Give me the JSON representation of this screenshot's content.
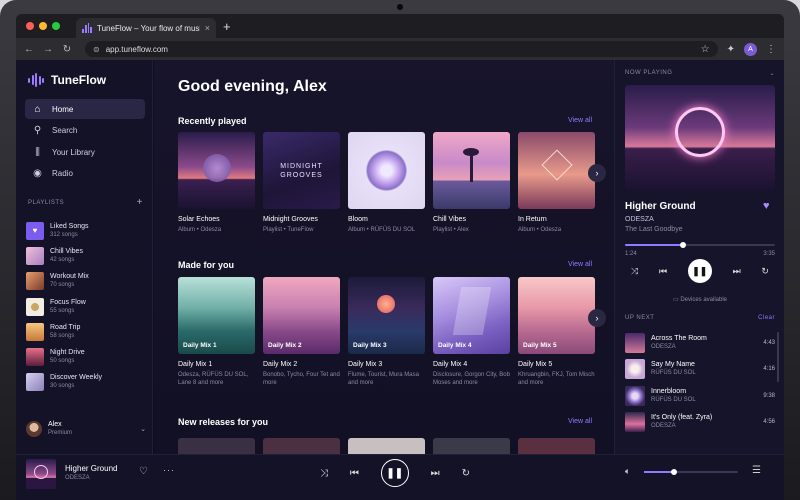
{
  "browser": {
    "tab_title": "TuneFlow – Your flow of music",
    "tab_close": "×",
    "new_tab": "+",
    "url": "app.tuneflow.com",
    "profile_initial": "A",
    "dot_colors": [
      "#ff5f57",
      "#febc2e",
      "#28c840"
    ]
  },
  "brand": {
    "name": "TuneFlow",
    "accent": "#9b7bff"
  },
  "nav": [
    {
      "label": "Home",
      "icon": "home-icon",
      "glyph": "⌂",
      "active": true
    },
    {
      "label": "Search",
      "icon": "search-icon",
      "glyph": "⚲",
      "active": false
    },
    {
      "label": "Your Library",
      "icon": "library-icon",
      "glyph": "⫼",
      "active": false
    },
    {
      "label": "Radio",
      "icon": "radio-icon",
      "glyph": "◉",
      "active": false
    }
  ],
  "playlists_header": "PLAYLISTS",
  "playlists_add": "+",
  "playlists": [
    {
      "name": "Liked Songs",
      "count": "312 songs",
      "color": "#7c5cf0",
      "glyph": "♥"
    },
    {
      "name": "Chill Vibes",
      "count": "42 songs",
      "color": "#d9a0c0",
      "glyph": ""
    },
    {
      "name": "Workout Mix",
      "count": "70 songs",
      "color": "#c86a4a",
      "glyph": ""
    },
    {
      "name": "Focus Flow",
      "count": "55 songs",
      "color": "#e8e2d8",
      "glyph": ""
    },
    {
      "name": "Road Trip",
      "count": "58 songs",
      "color": "#e0a15a",
      "glyph": ""
    },
    {
      "name": "Night Drive",
      "count": "50 songs",
      "color": "#c24a6a",
      "glyph": ""
    },
    {
      "name": "Discover Weekly",
      "count": "30 songs",
      "color": "#b8b0d8",
      "glyph": ""
    }
  ],
  "user": {
    "name": "Alex",
    "tier": "Premium"
  },
  "main": {
    "greeting": "Good evening, Alex",
    "recently_played": {
      "title": "Recently played",
      "view_all": "View all",
      "items": [
        {
          "title": "Solar Echoes",
          "sub": "Album • Odesza",
          "cover_text": ""
        },
        {
          "title": "Midnight Grooves",
          "sub": "Playlist • TuneFlow",
          "cover_text": "MIDNIGHT GROOVES"
        },
        {
          "title": "Bloom",
          "sub": "Album • RÜFÜS DU SOL",
          "cover_text": ""
        },
        {
          "title": "Chill Vibes",
          "sub": "Playlist • Alex",
          "cover_text": ""
        },
        {
          "title": "In Return",
          "sub": "Album • Odesza",
          "cover_text": ""
        }
      ]
    },
    "made_for_you": {
      "title": "Made for you",
      "view_all": "View all",
      "items": [
        {
          "label": "Daily Mix 1",
          "title": "Daily Mix 1",
          "sub": "Odesza, RÜFÜS DU SOL, Lane 8 and more"
        },
        {
          "label": "Daily Mix 2",
          "title": "Daily Mix 2",
          "sub": "Bonobo, Tycho, Four Tet and more"
        },
        {
          "label": "Daily Mix 3",
          "title": "Daily Mix 3",
          "sub": "Flume, Tourist, Mura Masa and more"
        },
        {
          "label": "Daily Mix 4",
          "title": "Daily Mix 4",
          "sub": "Disclosure, Gorgon City, Bob Moses and more"
        },
        {
          "label": "Daily Mix 5",
          "title": "Daily Mix 5",
          "sub": "Khruangbin, FKJ, Tom Misch and more"
        }
      ]
    },
    "new_releases": {
      "title": "New releases for you",
      "view_all": "View all"
    }
  },
  "now_playing": {
    "header": "NOW PLAYING",
    "title": "Higher Ground",
    "artist": "ODESZA",
    "album": "The Last Goodbye",
    "elapsed": "1:24",
    "duration": "3:35",
    "progress": 0.39,
    "devices": "Devices available"
  },
  "up_next": {
    "header": "UP NEXT",
    "clear": "Clear",
    "items": [
      {
        "title": "Across The Room",
        "artist": "ODESZA",
        "duration": "4:43"
      },
      {
        "title": "Say My Name",
        "artist": "RÜFÜS DU SOL",
        "duration": "4:16"
      },
      {
        "title": "Innerbloom",
        "artist": "RÜFÜS DU SOL",
        "duration": "9:38"
      },
      {
        "title": "It's Only (feat. Zyra)",
        "artist": "ODESZA",
        "duration": "4:56"
      }
    ]
  },
  "player": {
    "title": "Higher Ground",
    "artist": "ODESZA",
    "volume": 0.32
  }
}
